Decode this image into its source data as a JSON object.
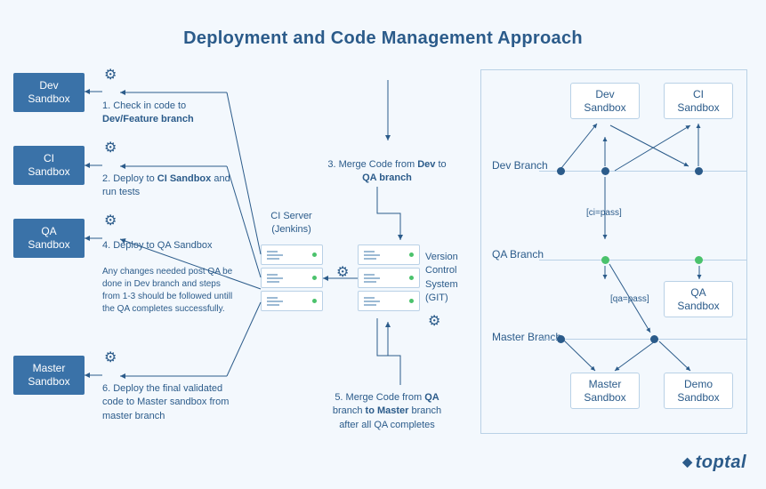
{
  "title": "Deployment and Code Management Approach",
  "sandboxes": {
    "dev": {
      "l1": "Dev",
      "l2": "Sandbox"
    },
    "ci": {
      "l1": "CI",
      "l2": "Sandbox"
    },
    "qa": {
      "l1": "QA",
      "l2": "Sandbox"
    },
    "master": {
      "l1": "Master",
      "l2": "Sandbox"
    }
  },
  "steps": {
    "s1_pre": "1. Check in code to ",
    "s1_bold": "Dev/Feature branch",
    "s2_pre": "2. Deploy to ",
    "s2_bold": "CI Sandbox",
    "s2_post": " and run tests",
    "s3_pre": "3. Merge Code from ",
    "s3_b1": "Dev",
    "s3_mid": " to ",
    "s3_b2": "QA branch",
    "s4": "4. Deploy to QA Sandbox",
    "note": "Any changes needed post QA be done in Dev branch and steps from 1-3 should be followed untill the QA completes successfully.",
    "s5_pre": "5. Merge Code from ",
    "s5_b1": "QA",
    "s5_mid": " branch ",
    "s5_b2": "to Master",
    "s5_post": " branch after all QA completes",
    "s6": "6. Deploy the final validated code to Master sandbox from master branch"
  },
  "labels": {
    "ciServer": "CI Server (Jenkins)",
    "vcs": "Version Control System (GIT)"
  },
  "panel": {
    "dev": {
      "l1": "Dev",
      "l2": "Sandbox"
    },
    "ci": {
      "l1": "CI",
      "l2": "Sandbox"
    },
    "qa": {
      "l1": "QA",
      "l2": "Sandbox"
    },
    "master": {
      "l1": "Master",
      "l2": "Sandbox"
    },
    "demo": {
      "l1": "Demo",
      "l2": "Sandbox"
    },
    "branch1": "Dev Branch",
    "branch2": "QA Branch",
    "branch3": "Master Branch",
    "cipass": "[ci=pass]",
    "qapass": "[qa=pass]"
  },
  "brand": "toptal"
}
